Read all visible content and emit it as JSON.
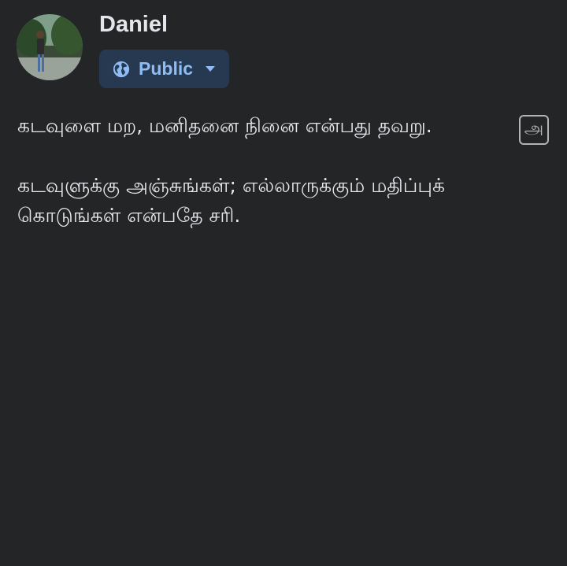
{
  "post": {
    "author_name": "Daniel",
    "audience": {
      "label": "Public",
      "icon": "globe-icon",
      "dropdown_icon": "caret-down-icon",
      "color": "#8fbcf5",
      "background": "#263951"
    },
    "translate_icon_glyph": "அ",
    "paragraphs": [
      "கடவுளை மற, மனிதனை நினை என்பது தவறு.",
      "கடவுளுக்கு அஞ்சுங்கள்; எல்லாருக்கும் மதிப்புக் கொடுங்கள் என்பதே சரி."
    ]
  },
  "theme": {
    "background": "#242526",
    "text": "#e4e6eb"
  }
}
